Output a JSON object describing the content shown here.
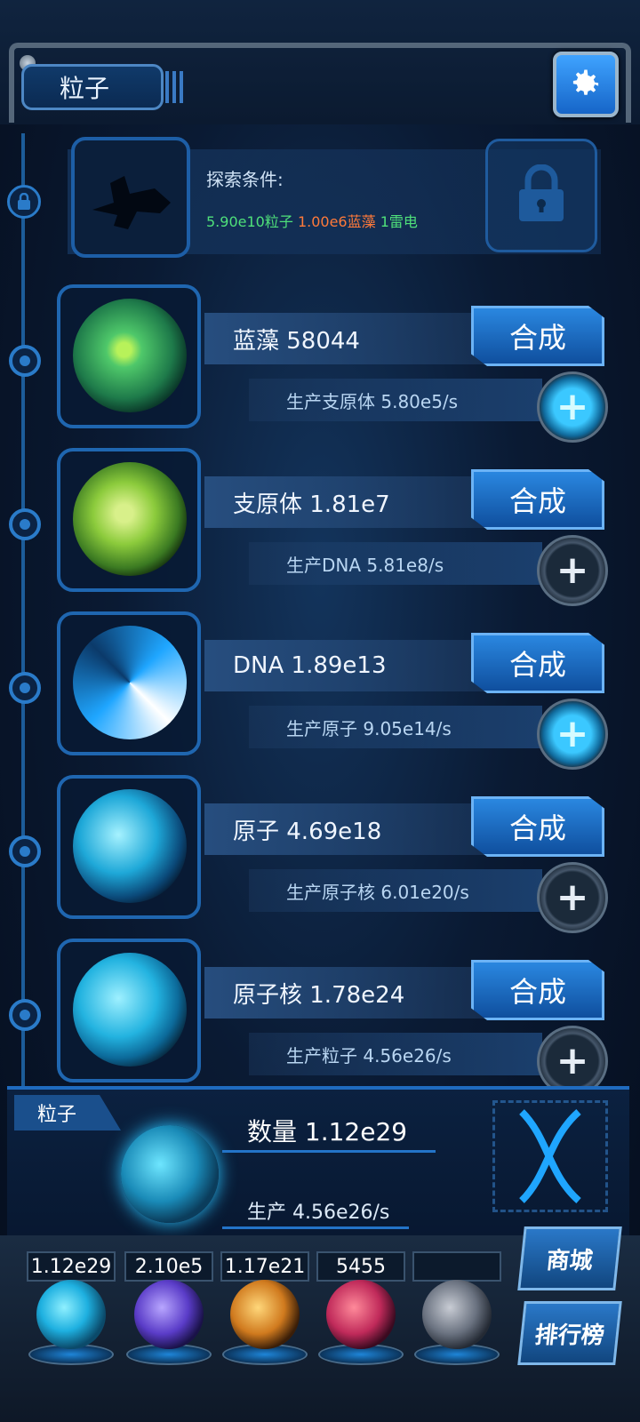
{
  "header": {
    "title": "粒子",
    "settings_icon": "gear-icon"
  },
  "explore": {
    "label": "探索条件:",
    "requirements": [
      {
        "text": "5.90e10粒子",
        "color": "#4fe07a"
      },
      {
        "text": "1.00e6蓝藻",
        "color": "#ff7a3a"
      },
      {
        "text": "1雷电",
        "color": "#4fe07a"
      }
    ]
  },
  "units": [
    {
      "name": "蓝藻 58044",
      "craft": "合成",
      "production": "生产支原体 5.80e5/s",
      "plus_active": true,
      "icon": "cyanobacteria-icon"
    },
    {
      "name": "支原体 1.81e7",
      "craft": "合成",
      "production": "生产DNA 5.81e8/s",
      "plus_active": false,
      "icon": "mycoplasma-icon"
    },
    {
      "name": "DNA 1.89e13",
      "craft": "合成",
      "production": "生产原子 9.05e14/s",
      "plus_active": true,
      "icon": "dna-icon"
    },
    {
      "name": "原子 4.69e18",
      "craft": "合成",
      "production": "生产原子核 6.01e20/s",
      "plus_active": false,
      "icon": "atom-icon"
    },
    {
      "name": "原子核 1.78e24",
      "craft": "合成",
      "production": "生产粒子 4.56e26/s",
      "plus_active": false,
      "icon": "nucleus-icon"
    }
  ],
  "particle": {
    "tab": "粒子",
    "count": "数量 1.12e29",
    "production": "生产 4.56e26/s"
  },
  "currencies": [
    {
      "value": "1.12e29",
      "icon": "particle-orb-icon"
    },
    {
      "value": "2.10e5",
      "icon": "lightning-orb-icon"
    },
    {
      "value": "1.17e21",
      "icon": "fire-orb-icon"
    },
    {
      "value": "5455",
      "icon": "brain-orb-icon"
    },
    {
      "value": "",
      "icon": "lock-orb-icon"
    }
  ],
  "side_buttons": {
    "shop": "商城",
    "ranking": "排行榜"
  }
}
